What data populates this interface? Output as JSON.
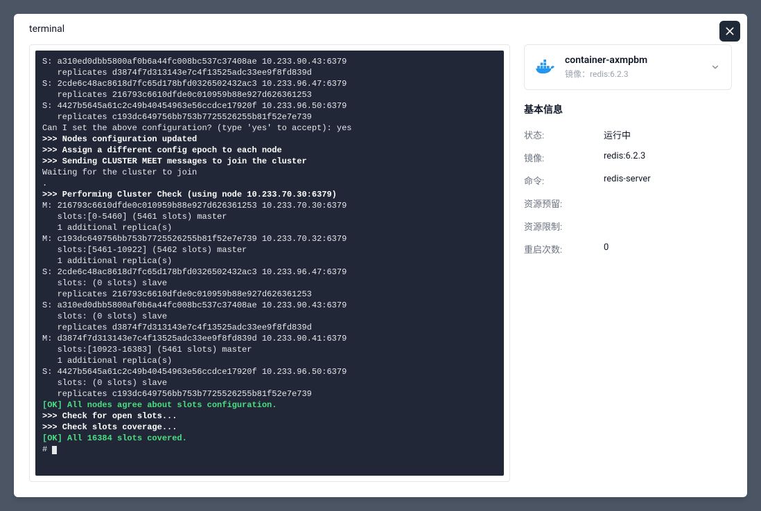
{
  "header": {
    "title": "terminal"
  },
  "terminal": {
    "lines": [
      {
        "t": "S: a310ed0dbb5800af0b6a44fc008bc537c37408ae 10.233.90.43:6379"
      },
      {
        "t": "   replicates d3874f7d313143e7c4f13525adc33ee9f8fd839d"
      },
      {
        "t": "S: 2cde6c48ac8618d7fc65d178bfd0326502432ac3 10.233.96.47:6379"
      },
      {
        "t": "   replicates 216793c6610dfde0c010959b88e927d626361253"
      },
      {
        "t": "S: 4427b5645a61c2c49b40454963e56ccdce17920f 10.233.96.50:6379"
      },
      {
        "t": "   replicates c193dc649756bb753b7725526255b81f52e7e739"
      },
      {
        "t": "Can I set the above configuration? (type 'yes' to accept): yes"
      },
      {
        "t": ">>> Nodes configuration updated",
        "cls": "t-bold"
      },
      {
        "t": ">>> Assign a different config epoch to each node",
        "cls": "t-bold"
      },
      {
        "t": ">>> Sending CLUSTER MEET messages to join the cluster",
        "cls": "t-bold"
      },
      {
        "t": "Waiting for the cluster to join"
      },
      {
        "t": "."
      },
      {
        "t": ">>> Performing Cluster Check (using node 10.233.70.30:6379)",
        "cls": "t-bold"
      },
      {
        "t": "M: 216793c6610dfde0c010959b88e927d626361253 10.233.70.30:6379"
      },
      {
        "t": "   slots:[0-5460] (5461 slots) master"
      },
      {
        "t": "   1 additional replica(s)"
      },
      {
        "t": "M: c193dc649756bb753b7725526255b81f52e7e739 10.233.70.32:6379"
      },
      {
        "t": "   slots:[5461-10922] (5462 slots) master"
      },
      {
        "t": "   1 additional replica(s)"
      },
      {
        "t": "S: 2cde6c48ac8618d7fc65d178bfd0326502432ac3 10.233.96.47:6379"
      },
      {
        "t": "   slots: (0 slots) slave"
      },
      {
        "t": "   replicates 216793c6610dfde0c010959b88e927d626361253"
      },
      {
        "t": "S: a310ed0dbb5800af0b6a44fc008bc537c37408ae 10.233.90.43:6379"
      },
      {
        "t": "   slots: (0 slots) slave"
      },
      {
        "t": "   replicates d3874f7d313143e7c4f13525adc33ee9f8fd839d"
      },
      {
        "t": "M: d3874f7d313143e7c4f13525adc33ee9f8fd839d 10.233.90.41:6379"
      },
      {
        "t": "   slots:[10923-16383] (5461 slots) master"
      },
      {
        "t": "   1 additional replica(s)"
      },
      {
        "t": "S: 4427b5645a61c2c49b40454963e56ccdce17920f 10.233.96.50:6379"
      },
      {
        "t": "   slots: (0 slots) slave"
      },
      {
        "t": "   replicates c193dc649756bb753b7725526255b81f52e7e739"
      },
      {
        "t": "[OK] All nodes agree about slots configuration.",
        "cls": "t-ok"
      },
      {
        "t": ">>> Check for open slots...",
        "cls": "t-bold"
      },
      {
        "t": ">>> Check slots coverage...",
        "cls": "t-bold"
      },
      {
        "t": "[OK] All 16384 slots covered.",
        "cls": "t-ok"
      }
    ],
    "prompt": "# "
  },
  "container": {
    "name": "container-axmpbm",
    "image_label": "镜像：",
    "image_value": "redis:6.2.3"
  },
  "basic_info": {
    "title": "基本信息",
    "rows": [
      {
        "label": "状态:",
        "value": "运行中"
      },
      {
        "label": "镜像:",
        "value": "redis:6.2.3"
      },
      {
        "label": "命令:",
        "value": "redis-server"
      },
      {
        "label": "资源预留:",
        "value": ""
      },
      {
        "label": "资源限制:",
        "value": ""
      },
      {
        "label": "重启次数:",
        "value": "0"
      }
    ]
  }
}
